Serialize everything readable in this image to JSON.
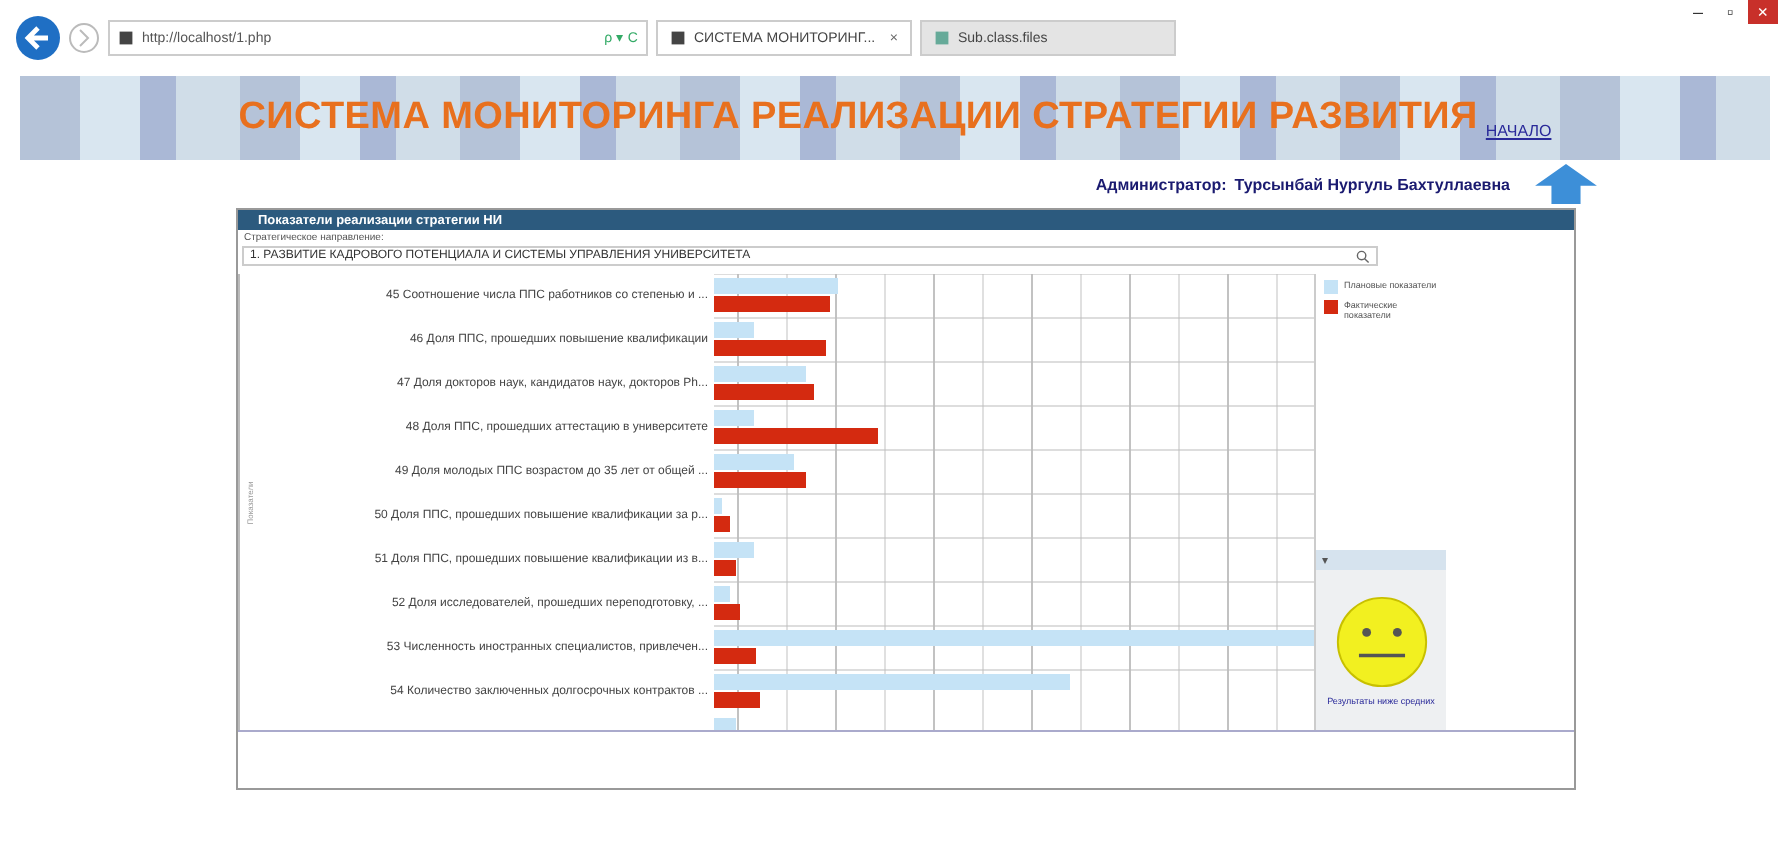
{
  "browser": {
    "address": "http://localhost/1.php",
    "address_controls": "ρ ▾ C",
    "tabs": [
      {
        "label": "СИСТЕМА МОНИТОРИНГ...",
        "selected": true,
        "close": "×"
      },
      {
        "label": "Sub.class.files",
        "selected": false
      }
    ],
    "window_controls": [
      "–",
      "▫",
      "×"
    ]
  },
  "banner": {
    "title": "СИСТЕМА МОНИТОРИНГА РЕАЛИЗАЦИИ СТРАТЕГИИ РАЗВИТИЯ",
    "link": "НАЧАЛО"
  },
  "user": {
    "label": "Администратор:",
    "name": "Турсынбай Нургуль Бахтуллаевна"
  },
  "panel": {
    "title": "Показатели реализации стратегии НИ",
    "direction_label": "Стратегическое направление:",
    "direction_value": "1. РАЗВИТИЕ КАДРОВОГО ПОТЕНЦИАЛА И СИСТЕМЫ УПРАВЛЕНИЯ УНИВЕРСИТЕТА",
    "axis_label": "Показатели",
    "rows": [
      {
        "label": "45 Соотношение числа ППС работников со степенью и ..."
      },
      {
        "label": "46 Доля ППС, прошедших повышение квалификации"
      },
      {
        "label": "47 Доля докторов наук, кандидатов наук, докторов Ph..."
      },
      {
        "label": "48 Доля ППС, прошедших аттестацию в университете"
      },
      {
        "label": "49 Доля молодых ППС возрастом до 35 лет от общей ..."
      },
      {
        "label": "50 Доля ППС, прошедших повышение квалификации за р..."
      },
      {
        "label": "51 Доля ППС, прошедших повышение квалификации из в..."
      },
      {
        "label": "52 Доля исследователей, прошедших переподготовку, ..."
      },
      {
        "label": "53 Численность иностранных специалистов, привлечен..."
      },
      {
        "label": "54 Количество заключенных долгосрочных контрактов ..."
      }
    ],
    "legend": [
      {
        "label": "Плановые показатели",
        "color": "#c5e3f6"
      },
      {
        "label": "Фактические показатели",
        "color": "#d42a10"
      }
    ],
    "collapse": "▾",
    "mood_caption": "Результаты ниже средних"
  }
}
